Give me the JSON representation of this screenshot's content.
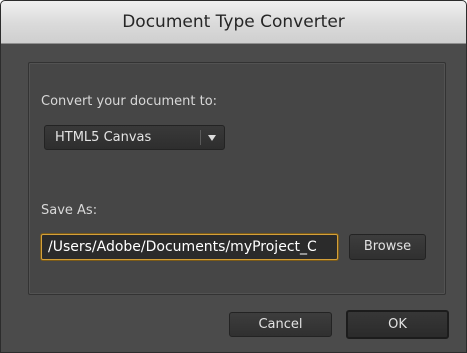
{
  "window": {
    "title": "Document Type Converter"
  },
  "convert": {
    "label": "Convert your document to:",
    "selected": "HTML5 Canvas"
  },
  "save_as": {
    "label": "Save As:",
    "path_value": "/Users/Adobe/Documents/myProject_C",
    "browse_label": "Browse"
  },
  "footer": {
    "cancel_label": "Cancel",
    "ok_label": "OK"
  },
  "colors": {
    "window_bg": "#4b4b4b",
    "title_bg": "#dadada",
    "field_focus_border": "#d4a03a"
  },
  "icons": {
    "dropdown": "chevron-down-icon"
  }
}
